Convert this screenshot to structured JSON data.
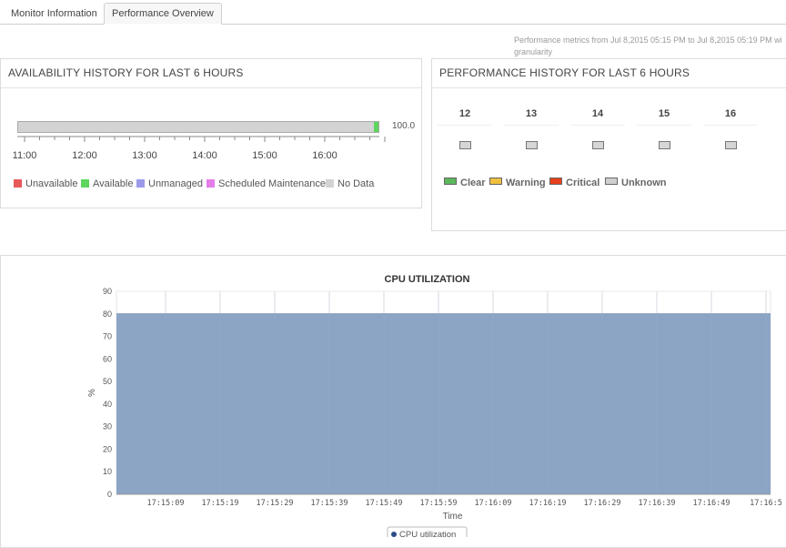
{
  "tabs": [
    {
      "label": "Monitor Information"
    },
    {
      "label": "Performance Overview",
      "active": true
    }
  ],
  "perf_note": {
    "line1": "Performance metrics from Jul 8,2015 05:15 PM to Jul 8,2015 05:19 PM wi",
    "line2": "granularity"
  },
  "availability": {
    "title": "AVAILABILITY HISTORY FOR LAST 6 HOURS",
    "value": "100.0",
    "available_fraction": 0.012,
    "hours": [
      "11:00",
      "12:00",
      "13:00",
      "14:00",
      "15:00",
      "16:00"
    ],
    "legend": [
      {
        "label": "Unavailable",
        "color": "#e8595a"
      },
      {
        "label": "Available",
        "color": "#5cd65c"
      },
      {
        "label": "Unmanaged",
        "color": "#9a9ae8"
      },
      {
        "label": "Scheduled Maintenance",
        "color": "#e47ee8"
      },
      {
        "label": "No Data",
        "color": "#d3d3d3"
      }
    ]
  },
  "performance": {
    "title": "PERFORMANCE HISTORY FOR LAST 6 HOURS",
    "hours": [
      "12",
      "13",
      "14",
      "15",
      "16"
    ],
    "status_per_hour": [
      "Unknown",
      "Unknown",
      "Unknown",
      "Unknown",
      "Unknown"
    ],
    "legend": [
      {
        "label": "Clear",
        "color": "#5cb85c"
      },
      {
        "label": "Warning",
        "color": "#f0c040"
      },
      {
        "label": "Critical",
        "color": "#e8401c"
      },
      {
        "label": "Unknown",
        "color": "#cfcfcf"
      }
    ]
  },
  "cpu_chart_labels": {
    "legend_label": "CPU utilization"
  },
  "chart_data": {
    "type": "area",
    "title": "CPU UTILIZATION",
    "xlabel": "Time",
    "ylabel": "%",
    "ylim": [
      0,
      90
    ],
    "yticks": [
      0,
      10,
      20,
      30,
      40,
      50,
      60,
      70,
      80,
      90
    ],
    "x": [
      "17:15:09",
      "17:15:19",
      "17:15:29",
      "17:15:39",
      "17:15:49",
      "17:15:59",
      "17:16:09",
      "17:16:19",
      "17:16:29",
      "17:16:39",
      "17:16:49",
      "17:16:5"
    ],
    "series": [
      {
        "name": "CPU utilization",
        "values": [
          80,
          80,
          80,
          80,
          80,
          80,
          80,
          80,
          80,
          80,
          80,
          80
        ],
        "color": "#8ca5c5"
      }
    ],
    "grid": true,
    "legend_position": "bottom"
  }
}
